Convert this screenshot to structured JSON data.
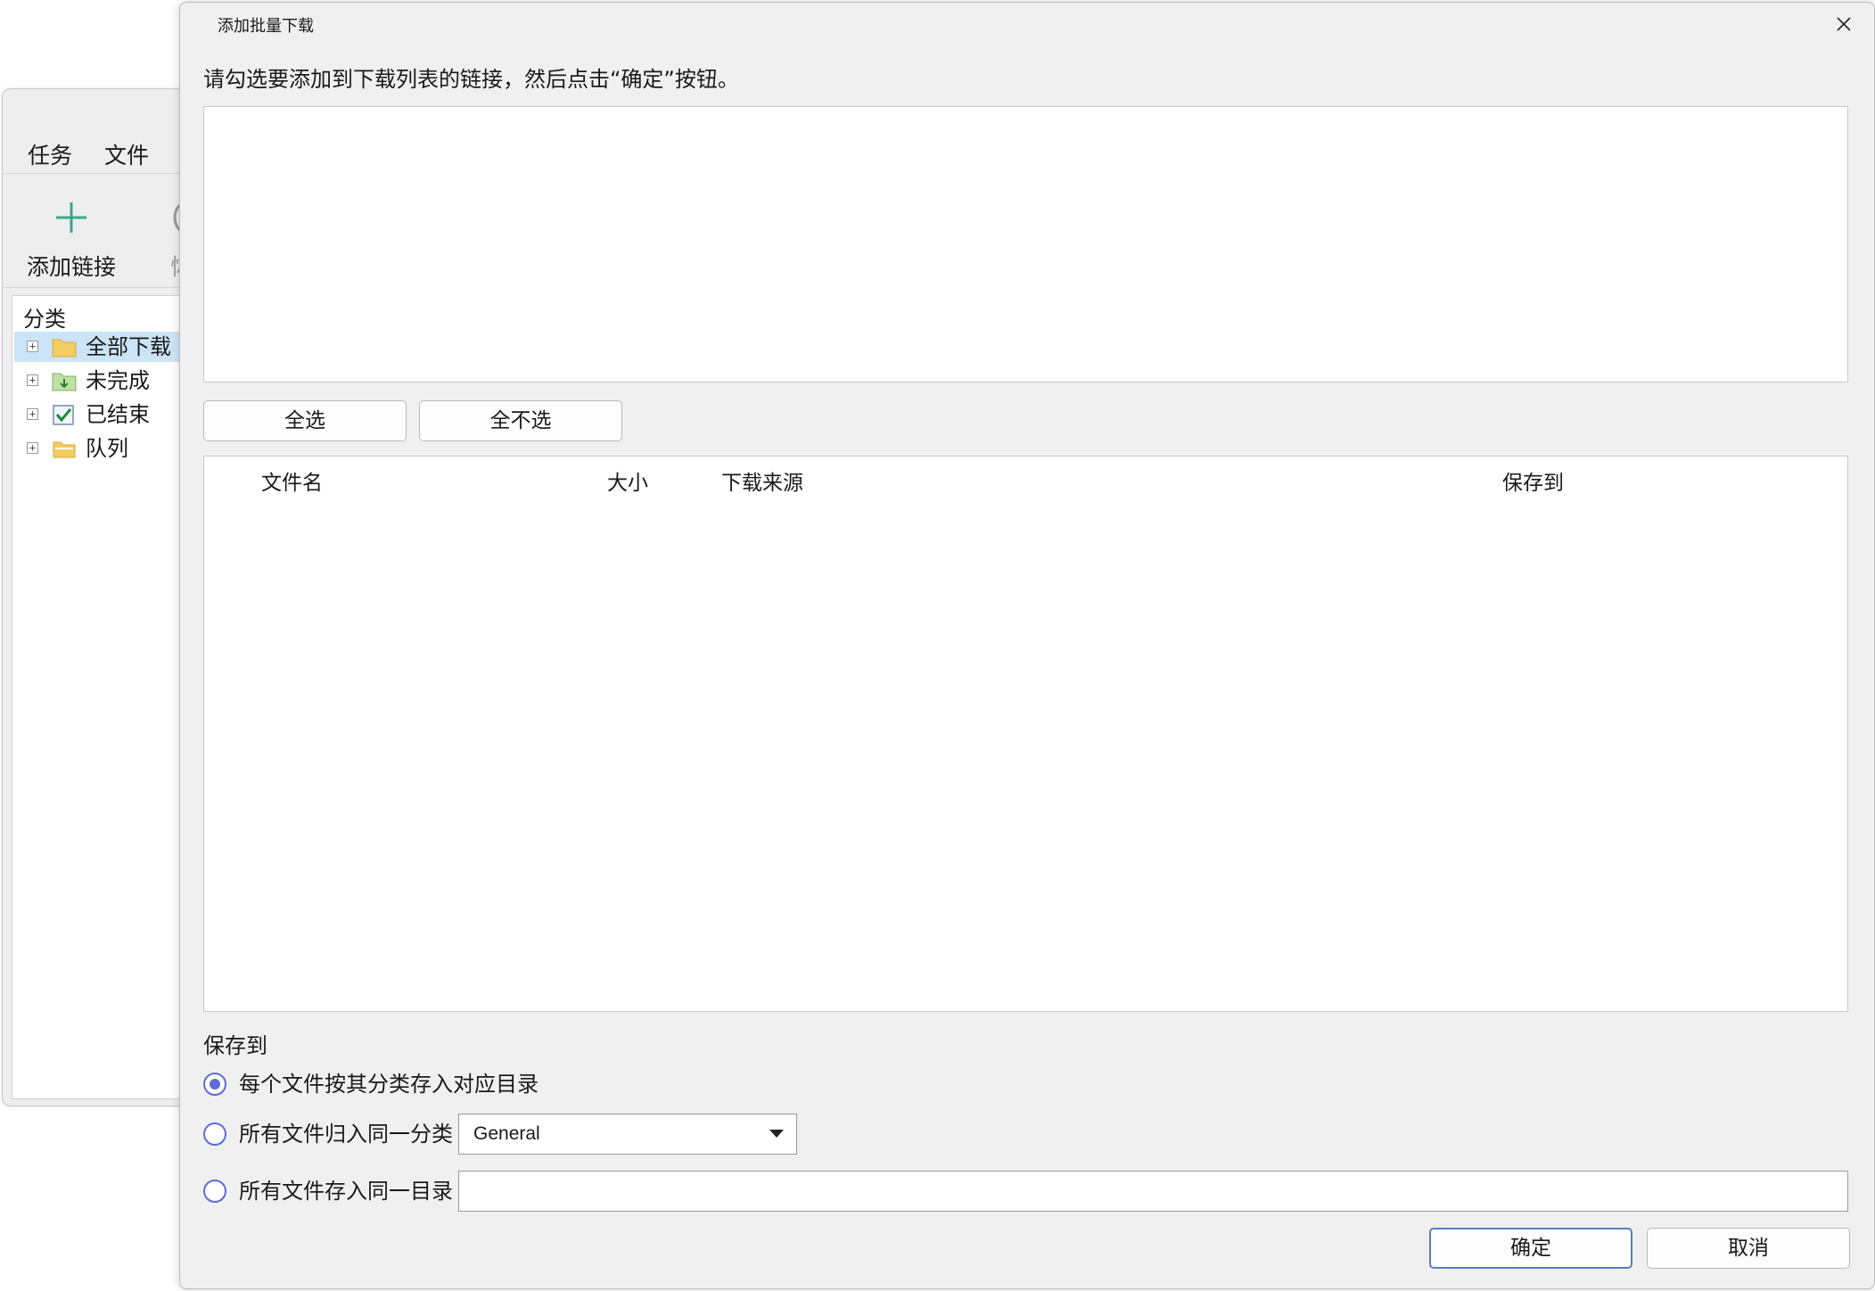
{
  "main_window": {
    "menu": [
      "任务",
      "文件"
    ],
    "toolbar": {
      "add_link_label": "添加链接",
      "resume_label": "恢复",
      "add_icon_color": "#3aa88a"
    },
    "tree": {
      "header": "分类",
      "items": [
        {
          "label": "全部下载",
          "icon": "folder-icon",
          "selected": true
        },
        {
          "label": "未完成",
          "icon": "folder-download-icon"
        },
        {
          "label": "已结束",
          "icon": "check-box-icon"
        },
        {
          "label": "队列",
          "icon": "folder-open-icon"
        }
      ]
    }
  },
  "dialog": {
    "title": "添加批量下载",
    "instruction": "请勾选要添加到下载列表的链接，然后点击“确定”按钮。",
    "select_all_label": "全选",
    "select_none_label": "全不选",
    "columns": {
      "filename": "文件名",
      "size": "大小",
      "source": "下载来源",
      "save_to": "保存到"
    },
    "save_section_label": "保存到",
    "options": {
      "per_category": "每个文件按其分类存入对应目录",
      "same_category": "所有文件归入同一分类",
      "same_directory": "所有文件存入同一目录"
    },
    "selected_option": "per_category",
    "category_value": "General",
    "directory_value": "",
    "ok_label": "确定",
    "cancel_label": "取消",
    "accent_color": "#5e6bd8"
  }
}
